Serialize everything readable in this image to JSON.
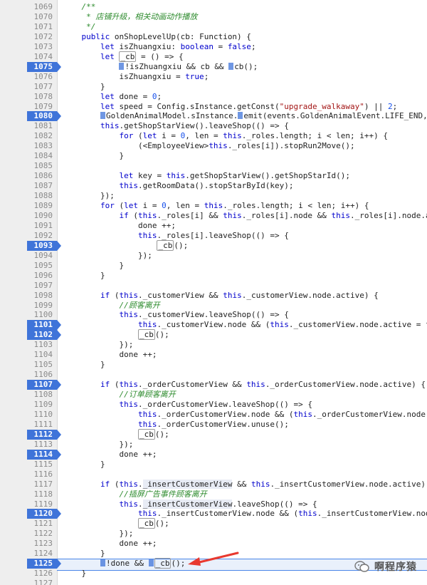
{
  "lines": [
    {
      "n": "1069",
      "bp": false,
      "html": "    <span class='cm'>/**</span>"
    },
    {
      "n": "1070",
      "bp": false,
      "html": "    <span class='cm'> * 店铺升级，相关动画动作播放</span>"
    },
    {
      "n": "1071",
      "bp": false,
      "html": "    <span class='cm'> */</span>"
    },
    {
      "n": "1072",
      "bp": false,
      "html": "    <span class='kw'>public</span> onShopLevelUp(cb: Function) {"
    },
    {
      "n": "1073",
      "bp": false,
      "html": "        <span class='kw'>let</span> isZhuangxiu: <span class='kw'>boolean</span> = <span class='kw'>false</span>;"
    },
    {
      "n": "1074",
      "bp": false,
      "html": "        <span class='kw'>let</span> <span class='cb'>_cb</span> = () => {"
    },
    {
      "n": "1075",
      "bp": true,
      "html": "            <span class='mk'></span>!isZhuangxiu && cb && <span class='mk'></span>cb();"
    },
    {
      "n": "1076",
      "bp": false,
      "html": "            isZhuangxiu = <span class='kw'>true</span>;"
    },
    {
      "n": "1077",
      "bp": false,
      "html": "        }"
    },
    {
      "n": "1078",
      "bp": false,
      "html": "        <span class='kw'>let</span> done = <span class='num'>0</span>;"
    },
    {
      "n": "1079",
      "bp": false,
      "html": "        <span class='kw'>let</span> speed = Config.sInstance.getConst(<span class='str'>\"upgrade_walkaway\"</span>) || <span class='num'>2</span>;"
    },
    {
      "n": "1080",
      "bp": true,
      "html": "        <span class='mk'></span>GoldenAnimalModel.sInstance.<span class='mk'></span>emit(events.GoldenAnimalEvent.LIFE_END,"
    },
    {
      "n": "1081",
      "bp": false,
      "html": "        <span class='th'>this</span>.getShopStarView().leaveShop(() => {"
    },
    {
      "n": "1082",
      "bp": false,
      "html": "            <span class='kw'>for</span> (<span class='kw'>let</span> i = <span class='num'>0</span>, len = <span class='th'>this</span>._roles.length; i < len; i++) {"
    },
    {
      "n": "1083",
      "bp": false,
      "html": "                (&lt;EmployeeView&gt;<span class='th'>this</span>._roles[i]).stopRun2Move();"
    },
    {
      "n": "1084",
      "bp": false,
      "html": "            }"
    },
    {
      "n": "1085",
      "bp": false,
      "html": ""
    },
    {
      "n": "1086",
      "bp": false,
      "html": "            <span class='kw'>let</span> key = <span class='th'>this</span>.getShopStarView().getShopStarId();"
    },
    {
      "n": "1087",
      "bp": false,
      "html": "            <span class='th'>this</span>.getRoomData().stopStarById(key);"
    },
    {
      "n": "1088",
      "bp": false,
      "html": "        });"
    },
    {
      "n": "1089",
      "bp": false,
      "html": "        <span class='kw'>for</span> (<span class='kw'>let</span> i = <span class='num'>0</span>, len = <span class='th'>this</span>._roles.length; i < len; i++) {"
    },
    {
      "n": "1090",
      "bp": false,
      "html": "            <span class='kw'>if</span> (<span class='th'>this</span>._roles[i] && <span class='th'>this</span>._roles[i].node && <span class='th'>this</span>._roles[i].node.ac"
    },
    {
      "n": "1091",
      "bp": false,
      "html": "                done ++;"
    },
    {
      "n": "1092",
      "bp": false,
      "html": "                <span class='th'>this</span>._roles[i].leaveShop(() => {"
    },
    {
      "n": "1093",
      "bp": true,
      "html": "                    <span class='cb'>_cb</span>();"
    },
    {
      "n": "1094",
      "bp": false,
      "html": "                });"
    },
    {
      "n": "1095",
      "bp": false,
      "html": "            }"
    },
    {
      "n": "1096",
      "bp": false,
      "html": "        }"
    },
    {
      "n": "1097",
      "bp": false,
      "html": ""
    },
    {
      "n": "1098",
      "bp": false,
      "html": "        <span class='kw'>if</span> (<span class='th'>this</span>._customerView && <span class='th'>this</span>._customerView.node.active) {"
    },
    {
      "n": "1099",
      "bp": false,
      "html": "            <span class='cm'>//顾客离开</span>"
    },
    {
      "n": "1100",
      "bp": false,
      "html": "            <span class='th'>this</span>._customerView.leaveShop(() => {"
    },
    {
      "n": "1101",
      "bp": true,
      "html": "                <span class='th'>this</span>._customerView.node && (<span class='th'>this</span>._customerView.node.active = fa"
    },
    {
      "n": "1102",
      "bp": true,
      "html": "                <span class='cb'>_cb</span>();"
    },
    {
      "n": "1103",
      "bp": false,
      "html": "            });"
    },
    {
      "n": "1104",
      "bp": false,
      "html": "            done ++;"
    },
    {
      "n": "1105",
      "bp": false,
      "html": "        }"
    },
    {
      "n": "1106",
      "bp": false,
      "html": ""
    },
    {
      "n": "1107",
      "bp": true,
      "html": "        <span class='kw'>if</span> (<span class='th'>this</span>._orderCustomerView && <span class='th'>this</span>._orderCustomerView.node.active) {"
    },
    {
      "n": "1108",
      "bp": false,
      "html": "            <span class='cm'>//订单顾客离开</span>"
    },
    {
      "n": "1109",
      "bp": false,
      "html": "            <span class='th'>this</span>._orderCustomerView.leaveShop(() => {"
    },
    {
      "n": "1110",
      "bp": false,
      "html": "                <span class='th'>this</span>._orderCustomerView.node && (<span class='th'>this</span>._orderCustomerView.node.a"
    },
    {
      "n": "1111",
      "bp": false,
      "html": "                <span class='th'>this</span>._orderCustomerView.unuse();"
    },
    {
      "n": "1112",
      "bp": true,
      "html": "                <span class='cb'>_cb</span>();"
    },
    {
      "n": "1113",
      "bp": false,
      "html": "            });"
    },
    {
      "n": "1114",
      "bp": true,
      "html": "            done ++;"
    },
    {
      "n": "1115",
      "bp": false,
      "html": "        }"
    },
    {
      "n": "1116",
      "bp": false,
      "html": ""
    },
    {
      "n": "1117",
      "bp": false,
      "html": "        <span class='kw'>if</span> (<span class='th'>this</span>.<span class='hl'>_insertCustomerView</span> && <span class='th'>this</span>._insertCustomerView.node.active) {"
    },
    {
      "n": "1118",
      "bp": false,
      "html": "            <span class='cm'>//插屏广告事件顾客离开</span>"
    },
    {
      "n": "1119",
      "bp": false,
      "html": "            <span class='th'>this</span>.<span class='hl'>_insertCustomerView</span>.leaveShop(() => {"
    },
    {
      "n": "1120",
      "bp": true,
      "html": "                <span class='th'>this</span>._insertCustomerView.node && (<span class='th'>this</span>._insertCustomerView.node"
    },
    {
      "n": "1121",
      "bp": false,
      "html": "                <span class='cb'>_cb</span>();"
    },
    {
      "n": "1122",
      "bp": false,
      "html": "            });"
    },
    {
      "n": "1123",
      "bp": false,
      "html": "            done ++;"
    },
    {
      "n": "1124",
      "bp": false,
      "html": "        }"
    },
    {
      "n": "1125",
      "bp": true,
      "html": "        <span class='mk'></span>!done && <span class='mk'></span><span class='cb'>_cb</span>();"
    },
    {
      "n": "1126",
      "bp": false,
      "html": "    }"
    },
    {
      "n": "1127",
      "bp": false,
      "html": ""
    }
  ],
  "watermark": {
    "text": "啊程序猿",
    "icon": "wechat-icon"
  },
  "colors": {
    "breakpoint": "#3f74d9",
    "gutter": "#eeeeee",
    "arrow": "#e8392f",
    "comment": "#2f8c2f",
    "keyword": "#0000cc",
    "string": "#a31515"
  }
}
